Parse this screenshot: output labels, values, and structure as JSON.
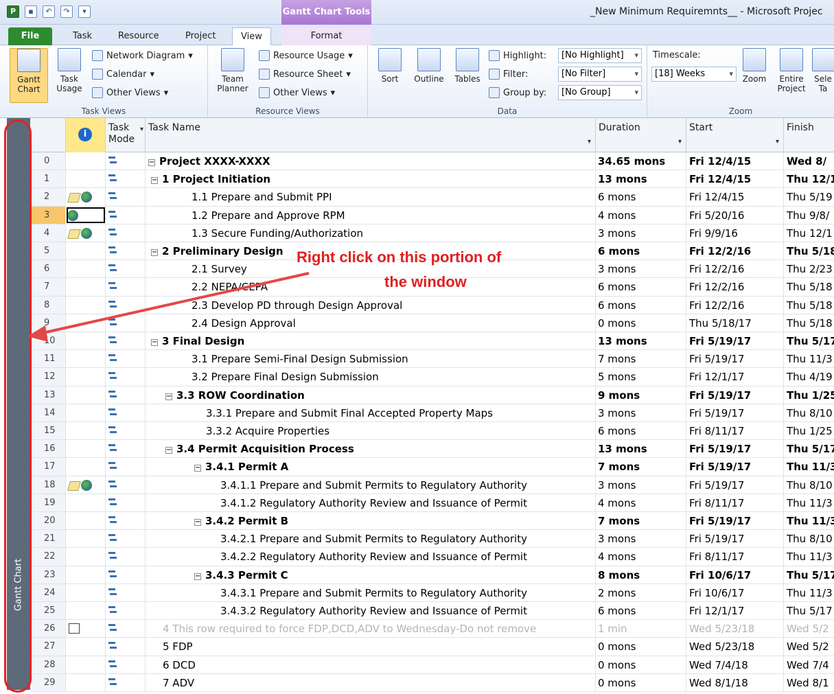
{
  "window": {
    "title": "_New Minimum Requiremnts__ - Microsoft Projec",
    "tools_tab": "Gantt Chart Tools",
    "app_icon": "P"
  },
  "ribbon_tabs": [
    "File",
    "Task",
    "Resource",
    "Project",
    "View",
    "Format"
  ],
  "ribbon": {
    "task_views": {
      "gantt_label": "Gantt Chart",
      "task_usage_label": "Task Usage",
      "network_diagram": "Network Diagram",
      "calendar": "Calendar",
      "other_views": "Other Views",
      "group_label": "Task Views"
    },
    "resource_views": {
      "team_planner": "Team Planner",
      "resource_usage": "Resource Usage",
      "resource_sheet": "Resource Sheet",
      "other_views": "Other Views",
      "group_label": "Resource Views"
    },
    "data": {
      "sort": "Sort",
      "outline": "Outline",
      "tables": "Tables",
      "highlight_label": "Highlight:",
      "highlight_value": "[No Highlight]",
      "filter_label": "Filter:",
      "filter_value": "[No Filter]",
      "groupby_label": "Group by:",
      "groupby_value": "[No Group]",
      "group_label": "Data"
    },
    "zoom": {
      "timescale_label": "Timescale:",
      "timescale_value": "[18] Weeks",
      "zoom": "Zoom",
      "entire_project": "Entire Project",
      "selected_tasks": "Sele Ta",
      "group_label": "Zoom"
    }
  },
  "sidebar": {
    "label": "Gantt Chart"
  },
  "columns": {
    "task_mode": "Task Mode",
    "task_name": "Task Name",
    "duration": "Duration",
    "start": "Start",
    "finish": "Finish"
  },
  "rows": [
    {
      "id": "0",
      "name": "Project XXXX-XXXX",
      "indent": 0,
      "collapse": true,
      "duration": "34.65 mons",
      "start": "Fri 12/4/15",
      "finish": "Wed 8/",
      "bold": true,
      "icons": ""
    },
    {
      "id": "1",
      "name": "1 Project Initiation",
      "indent": 1,
      "collapse": true,
      "duration": "13 mons",
      "start": "Fri 12/4/15",
      "finish": "Thu 12/1",
      "bold": true,
      "icons": ""
    },
    {
      "id": "2",
      "name": "1.1 Prepare and Submit PPI",
      "indent": 3,
      "collapse": false,
      "duration": "6 mons",
      "start": "Fri 12/4/15",
      "finish": "Thu 5/19",
      "bold": false,
      "icons": "note-globe"
    },
    {
      "id": "3",
      "name": "1.2 Prepare and Approve RPM",
      "indent": 3,
      "collapse": false,
      "duration": "4 mons",
      "start": "Fri 5/20/16",
      "finish": "Thu 9/8/",
      "bold": false,
      "icons": "globe",
      "selected": true
    },
    {
      "id": "4",
      "name": "1.3 Secure Funding/Authorization",
      "indent": 3,
      "collapse": false,
      "duration": "3 mons",
      "start": "Fri 9/9/16",
      "finish": "Thu 12/1",
      "bold": false,
      "icons": "note-globe"
    },
    {
      "id": "5",
      "name": "2 Preliminary Design",
      "indent": 1,
      "collapse": true,
      "duration": "6 mons",
      "start": "Fri 12/2/16",
      "finish": "Thu 5/18",
      "bold": true,
      "icons": ""
    },
    {
      "id": "6",
      "name": "2.1 Survey",
      "indent": 3,
      "collapse": false,
      "duration": "3 mons",
      "start": "Fri 12/2/16",
      "finish": "Thu 2/23",
      "bold": false,
      "icons": ""
    },
    {
      "id": "7",
      "name": "2.2 NEPA/CEPA",
      "indent": 3,
      "collapse": false,
      "duration": "6 mons",
      "start": "Fri 12/2/16",
      "finish": "Thu 5/18",
      "bold": false,
      "icons": ""
    },
    {
      "id": "8",
      "name": "2.3 Develop PD through Design Approval",
      "indent": 3,
      "collapse": false,
      "duration": "6 mons",
      "start": "Fri 12/2/16",
      "finish": "Thu 5/18",
      "bold": false,
      "icons": ""
    },
    {
      "id": "9",
      "name": "2.4 Design Approval",
      "indent": 3,
      "collapse": false,
      "duration": "0 mons",
      "start": "Thu 5/18/17",
      "finish": "Thu 5/18",
      "bold": false,
      "icons": ""
    },
    {
      "id": "10",
      "name": "3 Final Design",
      "indent": 1,
      "collapse": true,
      "duration": "13 mons",
      "start": "Fri 5/19/17",
      "finish": "Thu 5/17",
      "bold": true,
      "icons": ""
    },
    {
      "id": "11",
      "name": "3.1 Prepare Semi-Final Design Submission",
      "indent": 3,
      "collapse": false,
      "duration": "7 mons",
      "start": "Fri 5/19/17",
      "finish": "Thu 11/3",
      "bold": false,
      "icons": ""
    },
    {
      "id": "12",
      "name": "3.2 Prepare Final Design Submission",
      "indent": 3,
      "collapse": false,
      "duration": "5 mons",
      "start": "Fri 12/1/17",
      "finish": "Thu 4/19",
      "bold": false,
      "icons": ""
    },
    {
      "id": "13",
      "name": "3.3 ROW Coordination",
      "indent": 2,
      "collapse": true,
      "duration": "9 mons",
      "start": "Fri 5/19/17",
      "finish": "Thu 1/25",
      "bold": true,
      "icons": ""
    },
    {
      "id": "14",
      "name": "3.3.1 Prepare and Submit Final Accepted Property Maps",
      "indent": 4,
      "collapse": false,
      "duration": "3 mons",
      "start": "Fri 5/19/17",
      "finish": "Thu 8/10",
      "bold": false,
      "icons": ""
    },
    {
      "id": "15",
      "name": "3.3.2 Acquire Properties",
      "indent": 4,
      "collapse": false,
      "duration": "6 mons",
      "start": "Fri 8/11/17",
      "finish": "Thu 1/25",
      "bold": false,
      "icons": ""
    },
    {
      "id": "16",
      "name": "3.4 Permit Acquisition Process",
      "indent": 2,
      "collapse": true,
      "duration": "13 mons",
      "start": "Fri 5/19/17",
      "finish": "Thu 5/17",
      "bold": true,
      "icons": ""
    },
    {
      "id": "17",
      "name": "3.4.1 Permit A",
      "indent": 4,
      "collapse": true,
      "duration": "7 mons",
      "start": "Fri 5/19/17",
      "finish": "Thu 11/3",
      "bold": true,
      "icons": ""
    },
    {
      "id": "18",
      "name": "3.4.1.1 Prepare and Submit Permits to Regulatory Authority",
      "indent": 5,
      "collapse": false,
      "duration": "3 mons",
      "start": "Fri 5/19/17",
      "finish": "Thu 8/10",
      "bold": false,
      "icons": "note-globe"
    },
    {
      "id": "19",
      "name": "3.4.1.2 Regulatory Authority Review and Issuance of Permit",
      "indent": 5,
      "collapse": false,
      "duration": "4 mons",
      "start": "Fri 8/11/17",
      "finish": "Thu 11/3",
      "bold": false,
      "icons": ""
    },
    {
      "id": "20",
      "name": "3.4.2 Permit B",
      "indent": 4,
      "collapse": true,
      "duration": "7 mons",
      "start": "Fri 5/19/17",
      "finish": "Thu 11/3",
      "bold": true,
      "icons": ""
    },
    {
      "id": "21",
      "name": "3.4.2.1 Prepare and Submit Permits to Regulatory Authority",
      "indent": 5,
      "collapse": false,
      "duration": "3 mons",
      "start": "Fri 5/19/17",
      "finish": "Thu 8/10",
      "bold": false,
      "icons": ""
    },
    {
      "id": "22",
      "name": "3.4.2.2 Regulatory Authority Review and Issuance of Permit",
      "indent": 5,
      "collapse": false,
      "duration": "4 mons",
      "start": "Fri 8/11/17",
      "finish": "Thu 11/3",
      "bold": false,
      "icons": ""
    },
    {
      "id": "23",
      "name": "3.4.3 Permit C",
      "indent": 4,
      "collapse": true,
      "duration": "8 mons",
      "start": "Fri 10/6/17",
      "finish": "Thu 5/17",
      "bold": true,
      "icons": ""
    },
    {
      "id": "24",
      "name": "3.4.3.1 Prepare and Submit Permits to Regulatory Authority",
      "indent": 5,
      "collapse": false,
      "duration": "2 mons",
      "start": "Fri 10/6/17",
      "finish": "Thu 11/3",
      "bold": false,
      "icons": ""
    },
    {
      "id": "25",
      "name": "3.4.3.2 Regulatory Authority Review and Issuance of Permit",
      "indent": 5,
      "collapse": false,
      "duration": "6 mons",
      "start": "Fri 12/1/17",
      "finish": "Thu 5/17",
      "bold": false,
      "icons": ""
    },
    {
      "id": "26",
      "name": "4 This row required to force FDP,DCD,ADV to Wednesday-Do not remove",
      "indent": 1,
      "collapse": false,
      "duration": "1 min",
      "start": "Wed 5/23/18",
      "finish": "Wed 5/2",
      "bold": false,
      "icons": "calendar",
      "gray": true
    },
    {
      "id": "27",
      "name": "5 FDP",
      "indent": 1,
      "collapse": false,
      "duration": "0 mons",
      "start": "Wed 5/23/18",
      "finish": "Wed 5/2",
      "bold": false,
      "icons": ""
    },
    {
      "id": "28",
      "name": "6 DCD",
      "indent": 1,
      "collapse": false,
      "duration": "0 mons",
      "start": "Wed 7/4/18",
      "finish": "Wed 7/4",
      "bold": false,
      "icons": ""
    },
    {
      "id": "29",
      "name": "7 ADV",
      "indent": 1,
      "collapse": false,
      "duration": "0 mons",
      "start": "Wed 8/1/18",
      "finish": "Wed 8/1",
      "bold": false,
      "icons": ""
    }
  ],
  "annotation": {
    "line1": "Right click on this portion of",
    "line2": "the window",
    "color": "#e02020"
  }
}
